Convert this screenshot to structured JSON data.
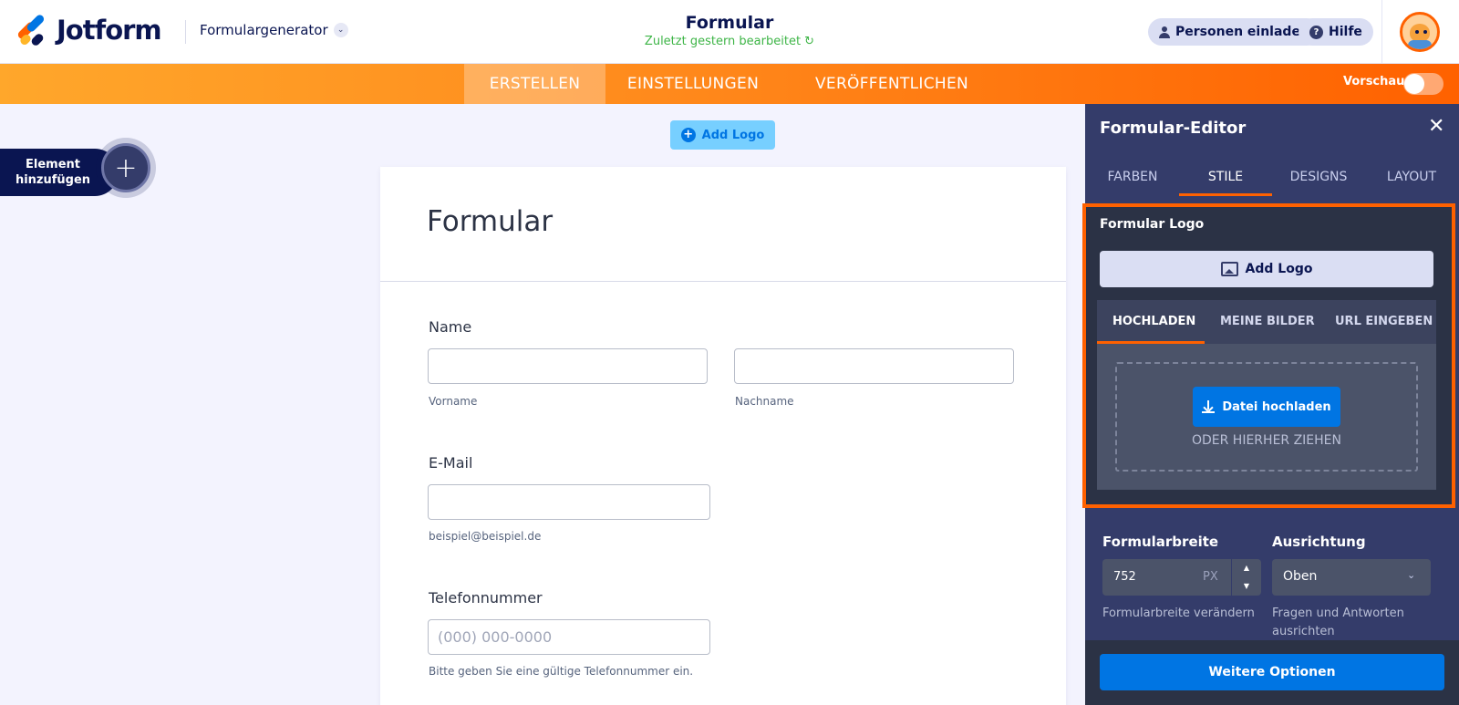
{
  "header": {
    "brand": "Jotform",
    "generator": "Formulargenerator",
    "form_title": "Formular",
    "last_edited": "Zuletzt gestern bearbeitet ↻",
    "invite_label": "Personen einladen",
    "help_label": "Hilfe"
  },
  "nav": {
    "tabs": [
      {
        "label": "ERSTELLEN"
      },
      {
        "label": "EINSTELLUNGEN"
      },
      {
        "label": "VERÖFFENTLICHEN"
      }
    ],
    "active_tab": "ERSTELLEN",
    "preview_label": "Vorschau",
    "preview_on": false
  },
  "sidebar": {
    "add_element_label": "Element hinzufügen"
  },
  "canvas": {
    "add_logo_label": "Add Logo",
    "form_title": "Formular",
    "fields": {
      "name_label": "Name",
      "first_sub": "Vorname",
      "last_sub": "Nachname",
      "email_label": "E-Mail",
      "email_sub": "beispiel@beispiel.de",
      "phone_label": "Telefonnummer",
      "phone_placeholder": "(000) 000-0000",
      "phone_sub": "Bitte geben Sie eine gültige Telefonnummer ein."
    }
  },
  "panel": {
    "title": "Formular-Editor",
    "tabs": [
      {
        "label": "FARBEN"
      },
      {
        "label": "STILE"
      },
      {
        "label": "DESIGNS"
      },
      {
        "label": "LAYOUT"
      }
    ],
    "active_tab": "STILE",
    "logo_section": {
      "title": "Formular Logo",
      "add_logo_label": "Add Logo",
      "upload_tabs": [
        {
          "label": "HOCHLADEN"
        },
        {
          "label": "MEINE BILDER"
        },
        {
          "label": "URL EINGEBEN"
        }
      ],
      "active_upload_tab": "HOCHLADEN",
      "upload_button": "Datei hochladen",
      "drag_text": "ODER HIERHER ZIEHEN"
    },
    "width_section": {
      "label": "Formularbreite",
      "value": "752",
      "unit": "PX",
      "help": "Formularbreite verändern"
    },
    "align_section": {
      "label": "Ausrichtung",
      "value": "Oben",
      "help": "Fragen und Antworten ausrichten"
    },
    "more_options": "Weitere Optionen"
  },
  "colors": {
    "brand_orange": "#ff6100",
    "brand_blue": "#0075e3",
    "panel_bg": "#343c6a"
  }
}
